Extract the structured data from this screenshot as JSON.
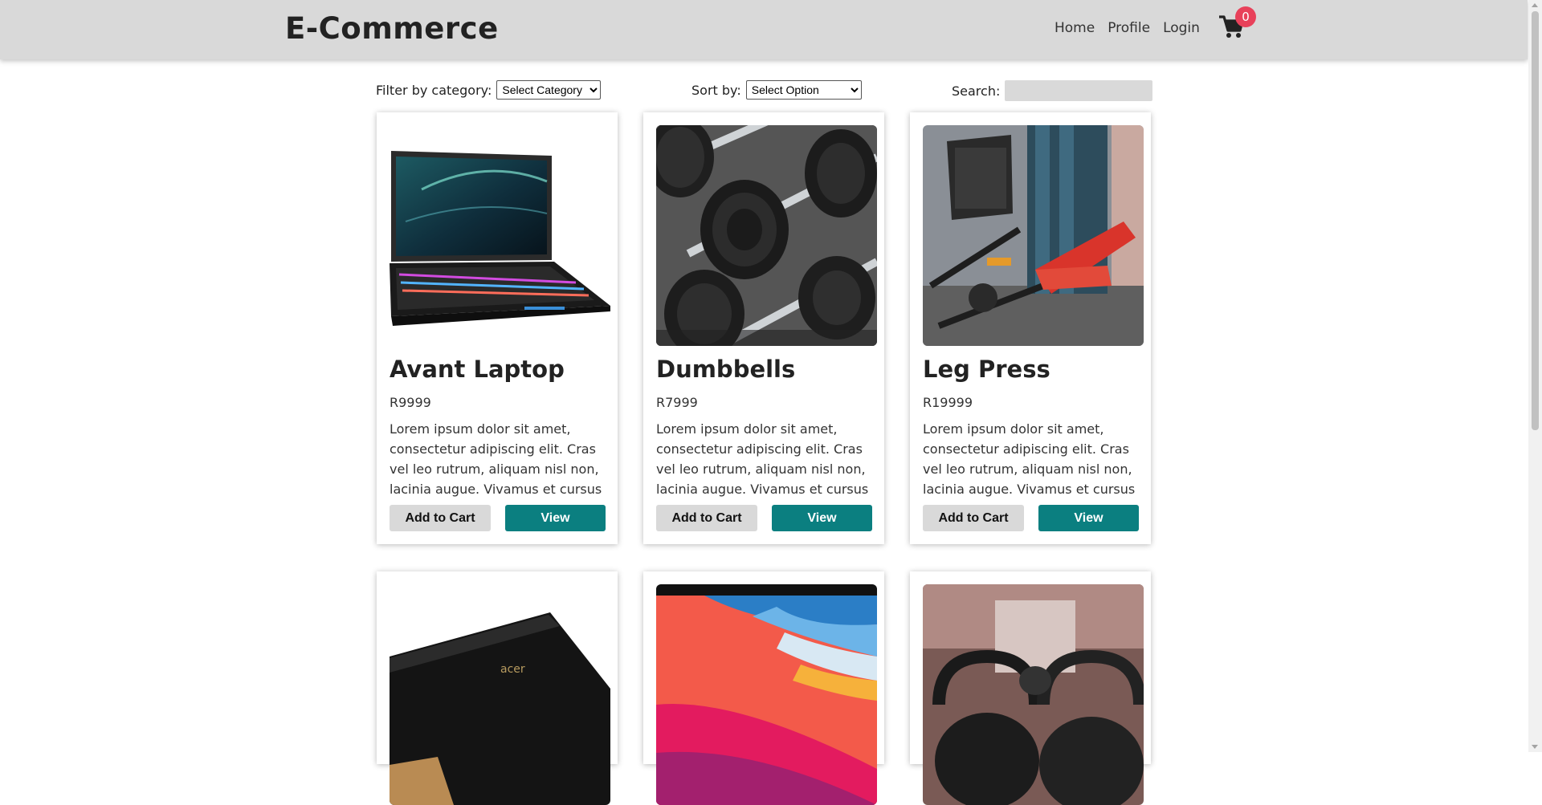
{
  "header": {
    "brand": "E-Commerce",
    "nav": {
      "home": "Home",
      "profile": "Profile",
      "login": "Login"
    },
    "cart_count": "0",
    "cart_icon": "shopping-cart-icon"
  },
  "toolbar": {
    "filter_label": "Filter by category:",
    "filter_value": "Select Category",
    "sort_label": "Sort by:",
    "sort_value": "Select Option",
    "search_label": "Search:",
    "search_value": ""
  },
  "buttons": {
    "add_to_cart": "Add to Cart",
    "view": "View"
  },
  "products": [
    {
      "name": "Avant Laptop",
      "price": "R9999",
      "description": "Lorem ipsum dolor sit amet, consectetur adipiscing elit. Cras vel leo rutrum, aliquam nisl non, lacinia augue. Vivamus et cursus",
      "image": "laptop"
    },
    {
      "name": "Dumbbells",
      "price": "R7999",
      "description": "Lorem ipsum dolor sit amet, consectetur adipiscing elit. Cras vel leo rutrum, aliquam nisl non, lacinia augue. Vivamus et cursus",
      "image": "dumbbells"
    },
    {
      "name": "Leg Press",
      "price": "R19999",
      "description": "Lorem ipsum dolor sit amet, consectetur adipiscing elit. Cras vel leo rutrum, aliquam nisl non, lacinia augue. Vivamus et cursus",
      "image": "leg-press"
    }
  ],
  "products_partial": [
    {
      "image": "acer-laptop"
    },
    {
      "image": "macbook-screen"
    },
    {
      "image": "kettlebells"
    }
  ],
  "colors": {
    "navbar": "#d9d9d9",
    "accent": "#0b7f80",
    "badge": "#e8415a"
  }
}
